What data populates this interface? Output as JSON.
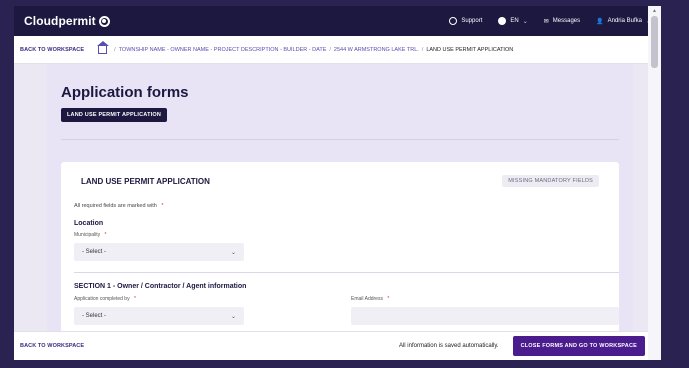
{
  "header": {
    "brand": "Cloudpermit",
    "support": "Support",
    "language": "EN",
    "messages": "Messages",
    "user": "Andria Bufka"
  },
  "breadcrumb": {
    "back": "BACK TO WORKSPACE",
    "project": "TOWNSHIP NAME - OWNER NAME - PROJECT DESCRIPTION - BUILDER - DATE",
    "address": "2544 W ARMSTRONG LAKE TRL.",
    "current": "LAND USE PERMIT APPLICATION",
    "separator": "/"
  },
  "page": {
    "title": "Application forms",
    "tag": "LAND USE PERMIT APPLICATION"
  },
  "form": {
    "title": "LAND USE PERMIT APPLICATION",
    "status": "MISSING MANDATORY FIELDS",
    "required_note": "All required fields are marked with",
    "required_marker": "*",
    "location_heading": "Location",
    "municipality_label": "Municipality",
    "municipality_value": "- Select -",
    "section1_heading": "SECTION 1 - Owner / Contractor / Agent information",
    "completed_by_label": "Application completed by",
    "completed_by_value": "- Select -",
    "email_label": "Email Address"
  },
  "footer": {
    "back": "BACK TO WORKSPACE",
    "saved_note": "All information is saved automatically.",
    "close_button": "CLOSE FORMS AND GO TO WORKSPACE"
  },
  "icons": {
    "support": "help-circle-icon",
    "language": "globe-icon",
    "messages": "messages-icon",
    "user": "user-icon",
    "home": "home-icon"
  },
  "colors": {
    "header_bg": "#1c1840",
    "accent": "#4a1c8e",
    "required": "#d12a4a"
  }
}
